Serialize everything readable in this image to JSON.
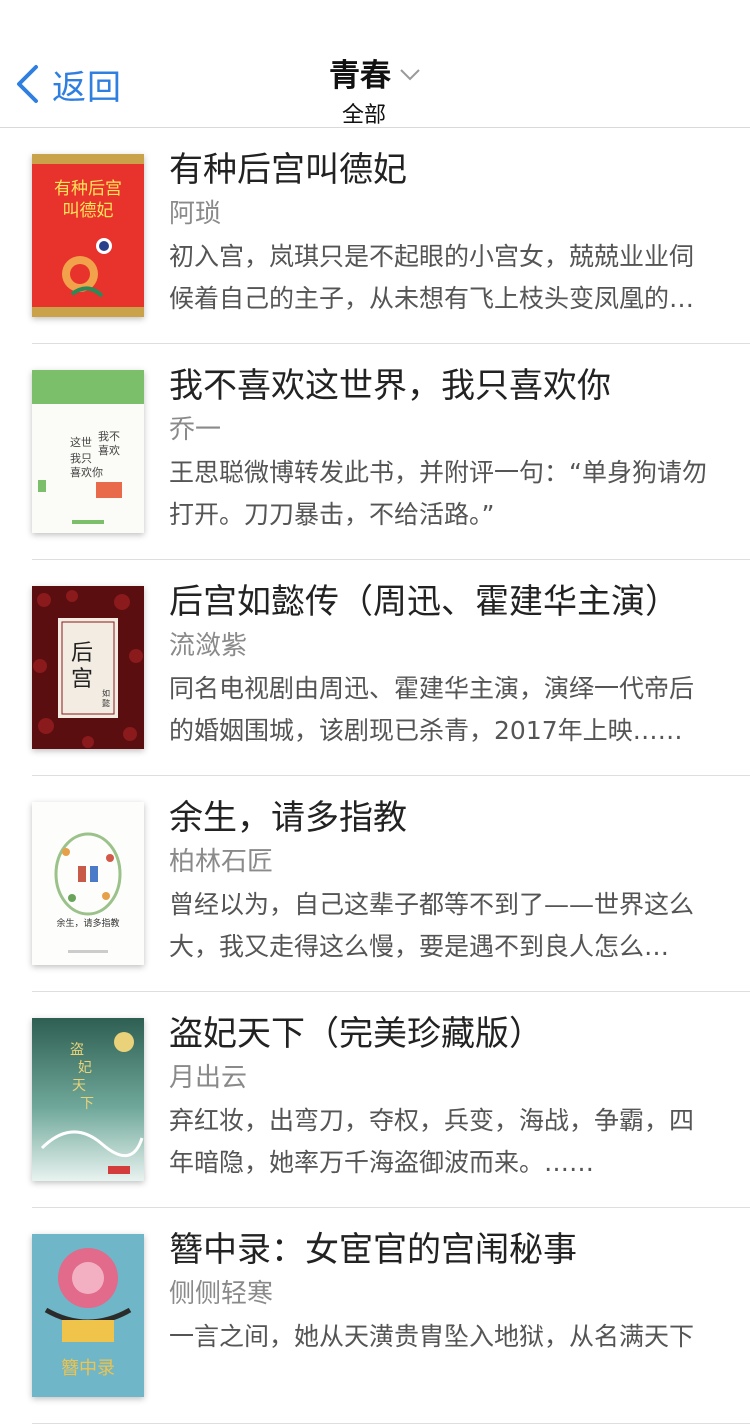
{
  "nav": {
    "back_label": "返回",
    "title": "青春",
    "subtitle": "全部"
  },
  "colors": {
    "accent": "#2f7fe0",
    "title": "#222222",
    "author": "#8a8a8a",
    "desc": "#555555"
  },
  "books": [
    {
      "title": "有种后宫叫德妃",
      "author": "阿琐",
      "desc": "初入宫，岚琪只是不起眼的小宫女，兢兢业业伺候着自己的主子，从未想有飞上枝头变凤凰的一天……",
      "cover_text": "有种后宫叫德妃"
    },
    {
      "title": "我不喜欢这世界，我只喜欢你",
      "author": "乔一",
      "desc": "王思聪微博转发此书，并附评一句：“单身狗请勿打开。刀刀暴击，不给活路。”",
      "cover_text": "我不喜欢这世界我只喜欢你"
    },
    {
      "title": "后宫如懿传（周迅、霍建华主演）",
      "author": "流潋紫",
      "desc": "同名电视剧由周迅、霍建华主演，演绎一代帝后的婚姻围城，该剧现已杀青，2017年上映……",
      "cover_text": "后宫如懿传"
    },
    {
      "title": "余生，请多指教",
      "author": "柏林石匠",
      "desc": "曾经以为，自己这辈子都等不到了——世界这么大，我又走得这么慢，要是遇不到良人怎么办……",
      "cover_text": "余生，请多指教"
    },
    {
      "title": "盗妃天下（完美珍藏版）",
      "author": "月出云",
      "desc": "弃红妆，出弯刀，夺权，兵变，海战，争霸，四年暗隐，她率万千海盗御波而来。……",
      "cover_text": "盗妃天下"
    },
    {
      "title": "簪中录：女宦官的宫闱秘事",
      "author": "侧侧轻寒",
      "desc": "一言之间，她从天潢贵胄坠入地狱，从名满天下",
      "cover_text": "簪中录"
    }
  ]
}
